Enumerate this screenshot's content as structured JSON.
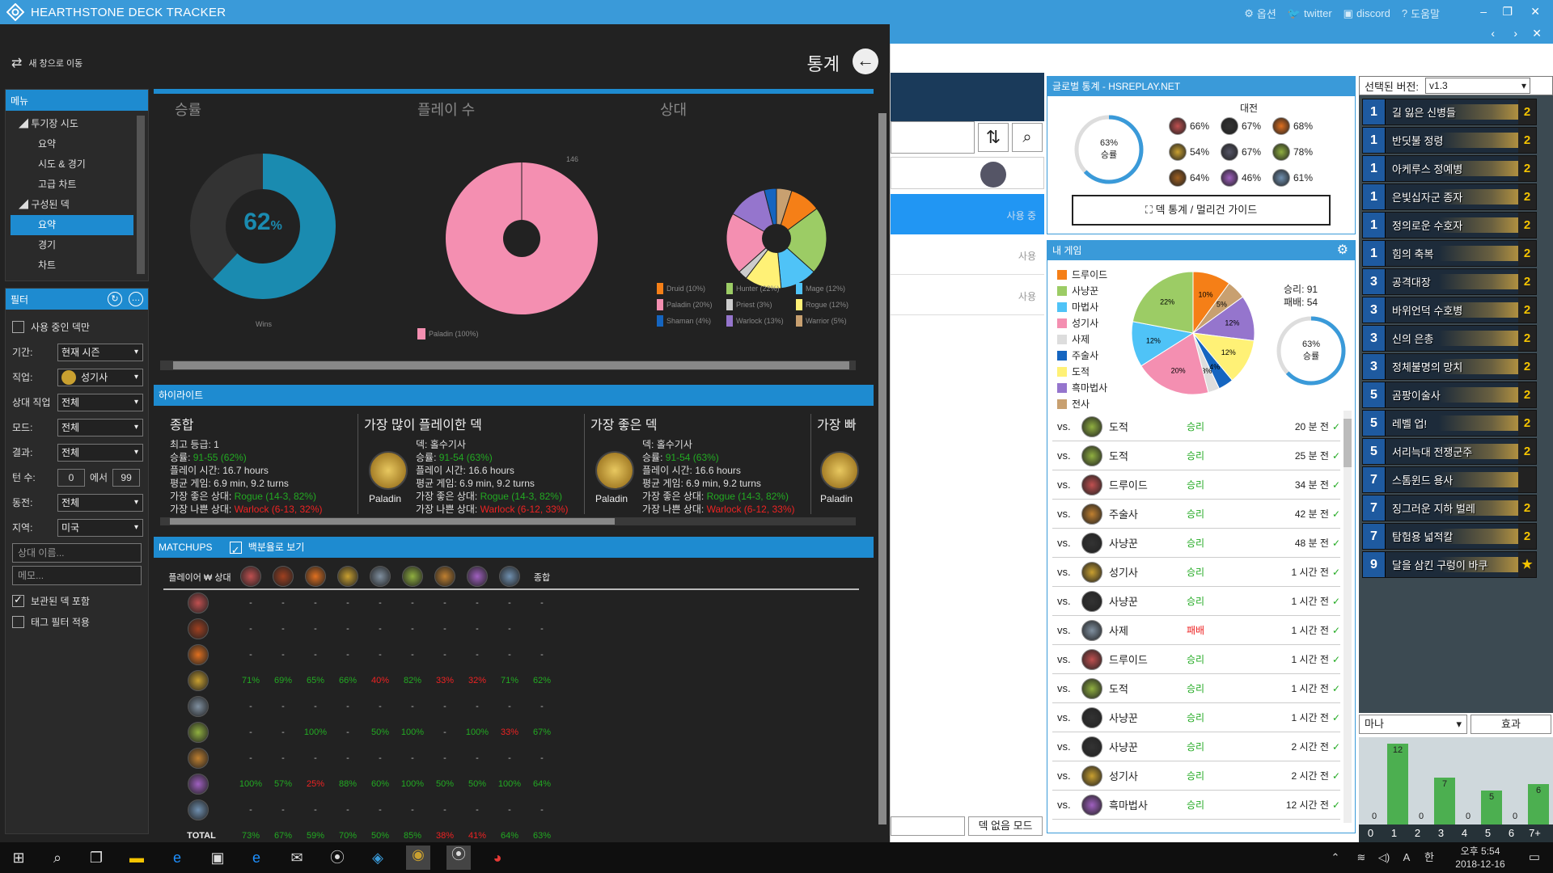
{
  "app": {
    "title": "HEARTHSTONE DECK TRACKER"
  },
  "titlebar": {
    "options": "옵션",
    "twitter": "twitter",
    "discord": "discord",
    "help": "도움말"
  },
  "stats": {
    "move_window": "새 창으로 이동",
    "title": "통계",
    "menu_header": "메뉴",
    "menu": {
      "arena": "투기장 시도",
      "arena_summary": "요약",
      "arena_runs": "시도 & 경기",
      "arena_charts": "고급 차트",
      "constructed": "구성된 덱",
      "con_summary": "요약",
      "con_games": "경기",
      "con_charts": "차트"
    },
    "filter_header": "필터",
    "filters": {
      "active_deck_only": "사용 중인 덱만",
      "period_label": "기간:",
      "period": "현재 시즌",
      "class_label": "직업:",
      "class": "성기사",
      "opp_label": "상대 직업",
      "opp": "전체",
      "mode_label": "모드:",
      "mode": "전체",
      "result_label": "결과:",
      "result": "전체",
      "turns_label": "턴 수:",
      "turns_min": "0",
      "turns_between": "에서",
      "turns_max": "99",
      "coin_label": "동전:",
      "coin": "전체",
      "region_label": "지역:",
      "region": "미국",
      "opp_name_placeholder": "상대 이름...",
      "note_placeholder": "메모...",
      "include_archived": "보관된 덱 포함",
      "apply_tag": "태그 필터 적용"
    },
    "charts": {
      "winrate_label": "승률",
      "winrate_value": "62",
      "winrate_unit": "%",
      "winrate_caption": "Wins",
      "played_label": "플레이 수",
      "played_legend": "Paladin (100%)",
      "played_value": "146",
      "opponent_label": "상대",
      "opp_legend": [
        "Druid (10%)",
        "Hunter (22%)",
        "Mage (12%)",
        "Paladin (20%)",
        "Priest (3%)",
        "Rogue (12%)",
        "Shaman (4%)",
        "Warlock (13%)",
        "Warrior (5%)"
      ],
      "opp_legend_colors": [
        "#f57f17",
        "#9ccc65",
        "#4fc3f7",
        "#f48fb1",
        "#cccccc",
        "#fff176",
        "#1565c0",
        "#9575cd",
        "#c8a070"
      ]
    },
    "highlights_header": "하이라이트",
    "highlights": {
      "total_title": "종합",
      "total_lines": [
        "최고 등급: 1",
        "승률: ",
        "플레이 시간: 16.7 hours",
        "평균 게임: 6.9 min, 9.2 turns",
        "가장 좋은 상대: ",
        "가장 나쁜 상대: "
      ],
      "total_winrate": "91-55 (62%)",
      "total_best": "Rogue (14-3, 82%)",
      "total_worst": "Warlock (6-13, 32%)",
      "most_played_title": "가장 많이 플레이한 덱",
      "best_deck_title": "가장 좋은 덱",
      "fourth_title": "가장 빠",
      "deck_name_line": "덱: 홀수기사",
      "deck_winrate": "91-54 (63%)",
      "deck_playtime": "플레이 시간: 16.6 hours",
      "deck_avg": "평균 게임: 6.9 min, 9.2 turns",
      "deck_best": "Rogue (14-3, 82%)",
      "deck_worst": "Warlock (6-12, 33%)",
      "winrate_prefix": "승률: ",
      "best_prefix": "가장 좋은 상대: ",
      "worst_prefix": "가장 나쁜 상대: ",
      "paladin": "Paladin"
    },
    "matchups_header": "MATCHUPS",
    "matchups_percent": "백분율로 보기",
    "matchups_corner": "플레이어 ₩ 상대",
    "matchups_total_col": "종합",
    "matchups_total_row": "TOTAL",
    "matchup_rows": [
      [
        "-",
        "-",
        "-",
        "-",
        "-",
        "-",
        "-",
        "-",
        "-",
        "-"
      ],
      [
        "-",
        "-",
        "-",
        "-",
        "-",
        "-",
        "-",
        "-",
        "-",
        "-"
      ],
      [
        "-",
        "-",
        "-",
        "-",
        "-",
        "-",
        "-",
        "-",
        "-",
        "-"
      ],
      [
        "71%",
        "69%",
        "65%",
        "66%",
        "40%",
        "82%",
        "33%",
        "32%",
        "71%",
        "62%"
      ],
      [
        "-",
        "-",
        "-",
        "-",
        "-",
        "-",
        "-",
        "-",
        "-",
        "-"
      ],
      [
        "-",
        "-",
        "100%",
        "-",
        "50%",
        "100%",
        "-",
        "100%",
        "33%",
        "67%"
      ],
      [
        "-",
        "-",
        "-",
        "-",
        "-",
        "-",
        "-",
        "-",
        "-",
        "-"
      ],
      [
        "100%",
        "57%",
        "25%",
        "88%",
        "60%",
        "100%",
        "50%",
        "50%",
        "100%",
        "64%"
      ],
      [
        "-",
        "-",
        "-",
        "-",
        "-",
        "-",
        "-",
        "-",
        "-",
        "-"
      ],
      [
        "73%",
        "67%",
        "59%",
        "70%",
        "50%",
        "85%",
        "38%",
        "41%",
        "64%",
        "63%"
      ]
    ],
    "matchup_red": [
      [
        3,
        4
      ],
      [
        3,
        6
      ],
      [
        3,
        7
      ],
      [
        5,
        8
      ],
      [
        7,
        2
      ],
      [
        9,
        6
      ],
      [
        9,
        7
      ]
    ]
  },
  "mid": {
    "use1": "사용 중",
    "use2": "사용",
    "use3": "사용",
    "no_deck_mode": "덱 없음 모드"
  },
  "global": {
    "header": "글로벌 통계 - HSREPLAY.NET",
    "match_label": "대전",
    "winrate": "63%",
    "winrate_label": "승률",
    "cells": [
      "66%",
      "67%",
      "68%",
      "54%",
      "67%",
      "78%",
      "64%",
      "46%",
      "61%"
    ],
    "guide_btn": "덱 통계 / 멀리건 가이드"
  },
  "mygames": {
    "header": "내 게임",
    "legend": [
      "드루이드",
      "사냥꾼",
      "마법사",
      "성기사",
      "사제",
      "주술사",
      "도적",
      "흑마법사",
      "전사"
    ],
    "legend_colors": [
      "#f57f17",
      "#9ccc65",
      "#4fc3f7",
      "#f48fb1",
      "#dddddd",
      "#1565c0",
      "#fff176",
      "#9575cd",
      "#c8a070"
    ],
    "wins": "승리: 91",
    "losses": "패배: 54",
    "winrate": "63%",
    "winrate_label": "승률",
    "pie_labels": [
      "10%",
      "5%",
      "12%",
      "12%",
      "4%",
      "3%",
      "20%",
      "12%",
      "22%"
    ],
    "vs": "vs.",
    "games": [
      {
        "cls": "도적",
        "res": "승리",
        "time": "20 분 전"
      },
      {
        "cls": "도적",
        "res": "승리",
        "time": "25 분 전"
      },
      {
        "cls": "드루이드",
        "res": "승리",
        "time": "34 분 전"
      },
      {
        "cls": "주술사",
        "res": "승리",
        "time": "42 분 전"
      },
      {
        "cls": "사냥꾼",
        "res": "승리",
        "time": "48 분 전"
      },
      {
        "cls": "성기사",
        "res": "승리",
        "time": "1 시간 전"
      },
      {
        "cls": "사냥꾼",
        "res": "승리",
        "time": "1 시간 전"
      },
      {
        "cls": "사제",
        "res": "패배",
        "time": "1 시간 전"
      },
      {
        "cls": "드루이드",
        "res": "승리",
        "time": "1 시간 전"
      },
      {
        "cls": "도적",
        "res": "승리",
        "time": "1 시간 전"
      },
      {
        "cls": "사냥꾼",
        "res": "승리",
        "time": "1 시간 전"
      },
      {
        "cls": "사냥꾼",
        "res": "승리",
        "time": "2 시간 전"
      },
      {
        "cls": "성기사",
        "res": "승리",
        "time": "2 시간 전"
      },
      {
        "cls": "흑마법사",
        "res": "승리",
        "time": "12 시간 전"
      }
    ]
  },
  "deck": {
    "version_label": "선택된 버전:",
    "version": "v1.3",
    "cards": [
      {
        "cost": "1",
        "name": "길 잃은 신병들",
        "count": "2"
      },
      {
        "cost": "1",
        "name": "반딧불 정령",
        "count": "2"
      },
      {
        "cost": "1",
        "name": "아케루스 정예병",
        "count": "2"
      },
      {
        "cost": "1",
        "name": "은빛십자군 종자",
        "count": "2"
      },
      {
        "cost": "1",
        "name": "정의로운 수호자",
        "count": "2"
      },
      {
        "cost": "1",
        "name": "힘의 축복",
        "count": "2"
      },
      {
        "cost": "3",
        "name": "공격대장",
        "count": "2"
      },
      {
        "cost": "3",
        "name": "바위언덕 수호병",
        "count": "2"
      },
      {
        "cost": "3",
        "name": "신의 은총",
        "count": "2"
      },
      {
        "cost": "3",
        "name": "정체불명의 망치",
        "count": "2"
      },
      {
        "cost": "5",
        "name": "곰팡이술사",
        "count": "2"
      },
      {
        "cost": "5",
        "name": "레벨 업!",
        "count": "2"
      },
      {
        "cost": "5",
        "name": "서리늑대 전쟁군주",
        "count": "2"
      },
      {
        "cost": "7",
        "name": "스톰윈드 용사",
        "count": ""
      },
      {
        "cost": "7",
        "name": "징그러운 지하 벌레",
        "count": "2"
      },
      {
        "cost": "7",
        "name": "탐험용 넓적칼",
        "count": "2"
      },
      {
        "cost": "9",
        "name": "달을 삼킨 구렁이 바쿠",
        "count": "★"
      }
    ],
    "mana_label": "마나",
    "effect_label": "효과",
    "mana_axis": [
      "0",
      "1",
      "2",
      "3",
      "4",
      "5",
      "6",
      "7+"
    ],
    "mana_values": [
      0,
      12,
      0,
      7,
      0,
      5,
      0,
      6
    ]
  },
  "taskbar": {
    "time": "오후 5:54",
    "date": "2018-12-16"
  }
}
